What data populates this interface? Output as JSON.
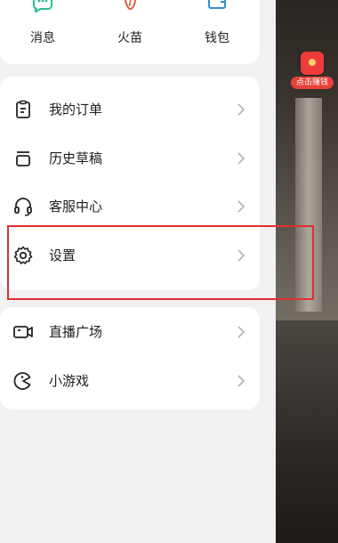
{
  "quick_actions": [
    {
      "label": "消息",
      "icon": "message-icon",
      "color": "#2cbf8f"
    },
    {
      "label": "火苗",
      "icon": "flame-icon",
      "color": "#e0603a"
    },
    {
      "label": "钱包",
      "icon": "wallet-icon",
      "color": "#2f8fd8"
    }
  ],
  "menu": {
    "items": [
      {
        "label": "我的订单",
        "icon": "order-clipboard-icon"
      },
      {
        "label": "历史草稿",
        "icon": "drafts-icon"
      },
      {
        "label": "客服中心",
        "icon": "headset-icon"
      },
      {
        "label": "设置",
        "icon": "gear-icon"
      }
    ]
  },
  "menu2": {
    "items": [
      {
        "label": "直播广场",
        "icon": "live-camera-icon"
      },
      {
        "label": "小游戏",
        "icon": "mini-game-icon"
      }
    ]
  },
  "promo": {
    "label": "点击赚钱",
    "icon": "red-packet-icon"
  },
  "colors": {
    "highlight": "#e03030",
    "accent_red": "#ef3b3b"
  }
}
